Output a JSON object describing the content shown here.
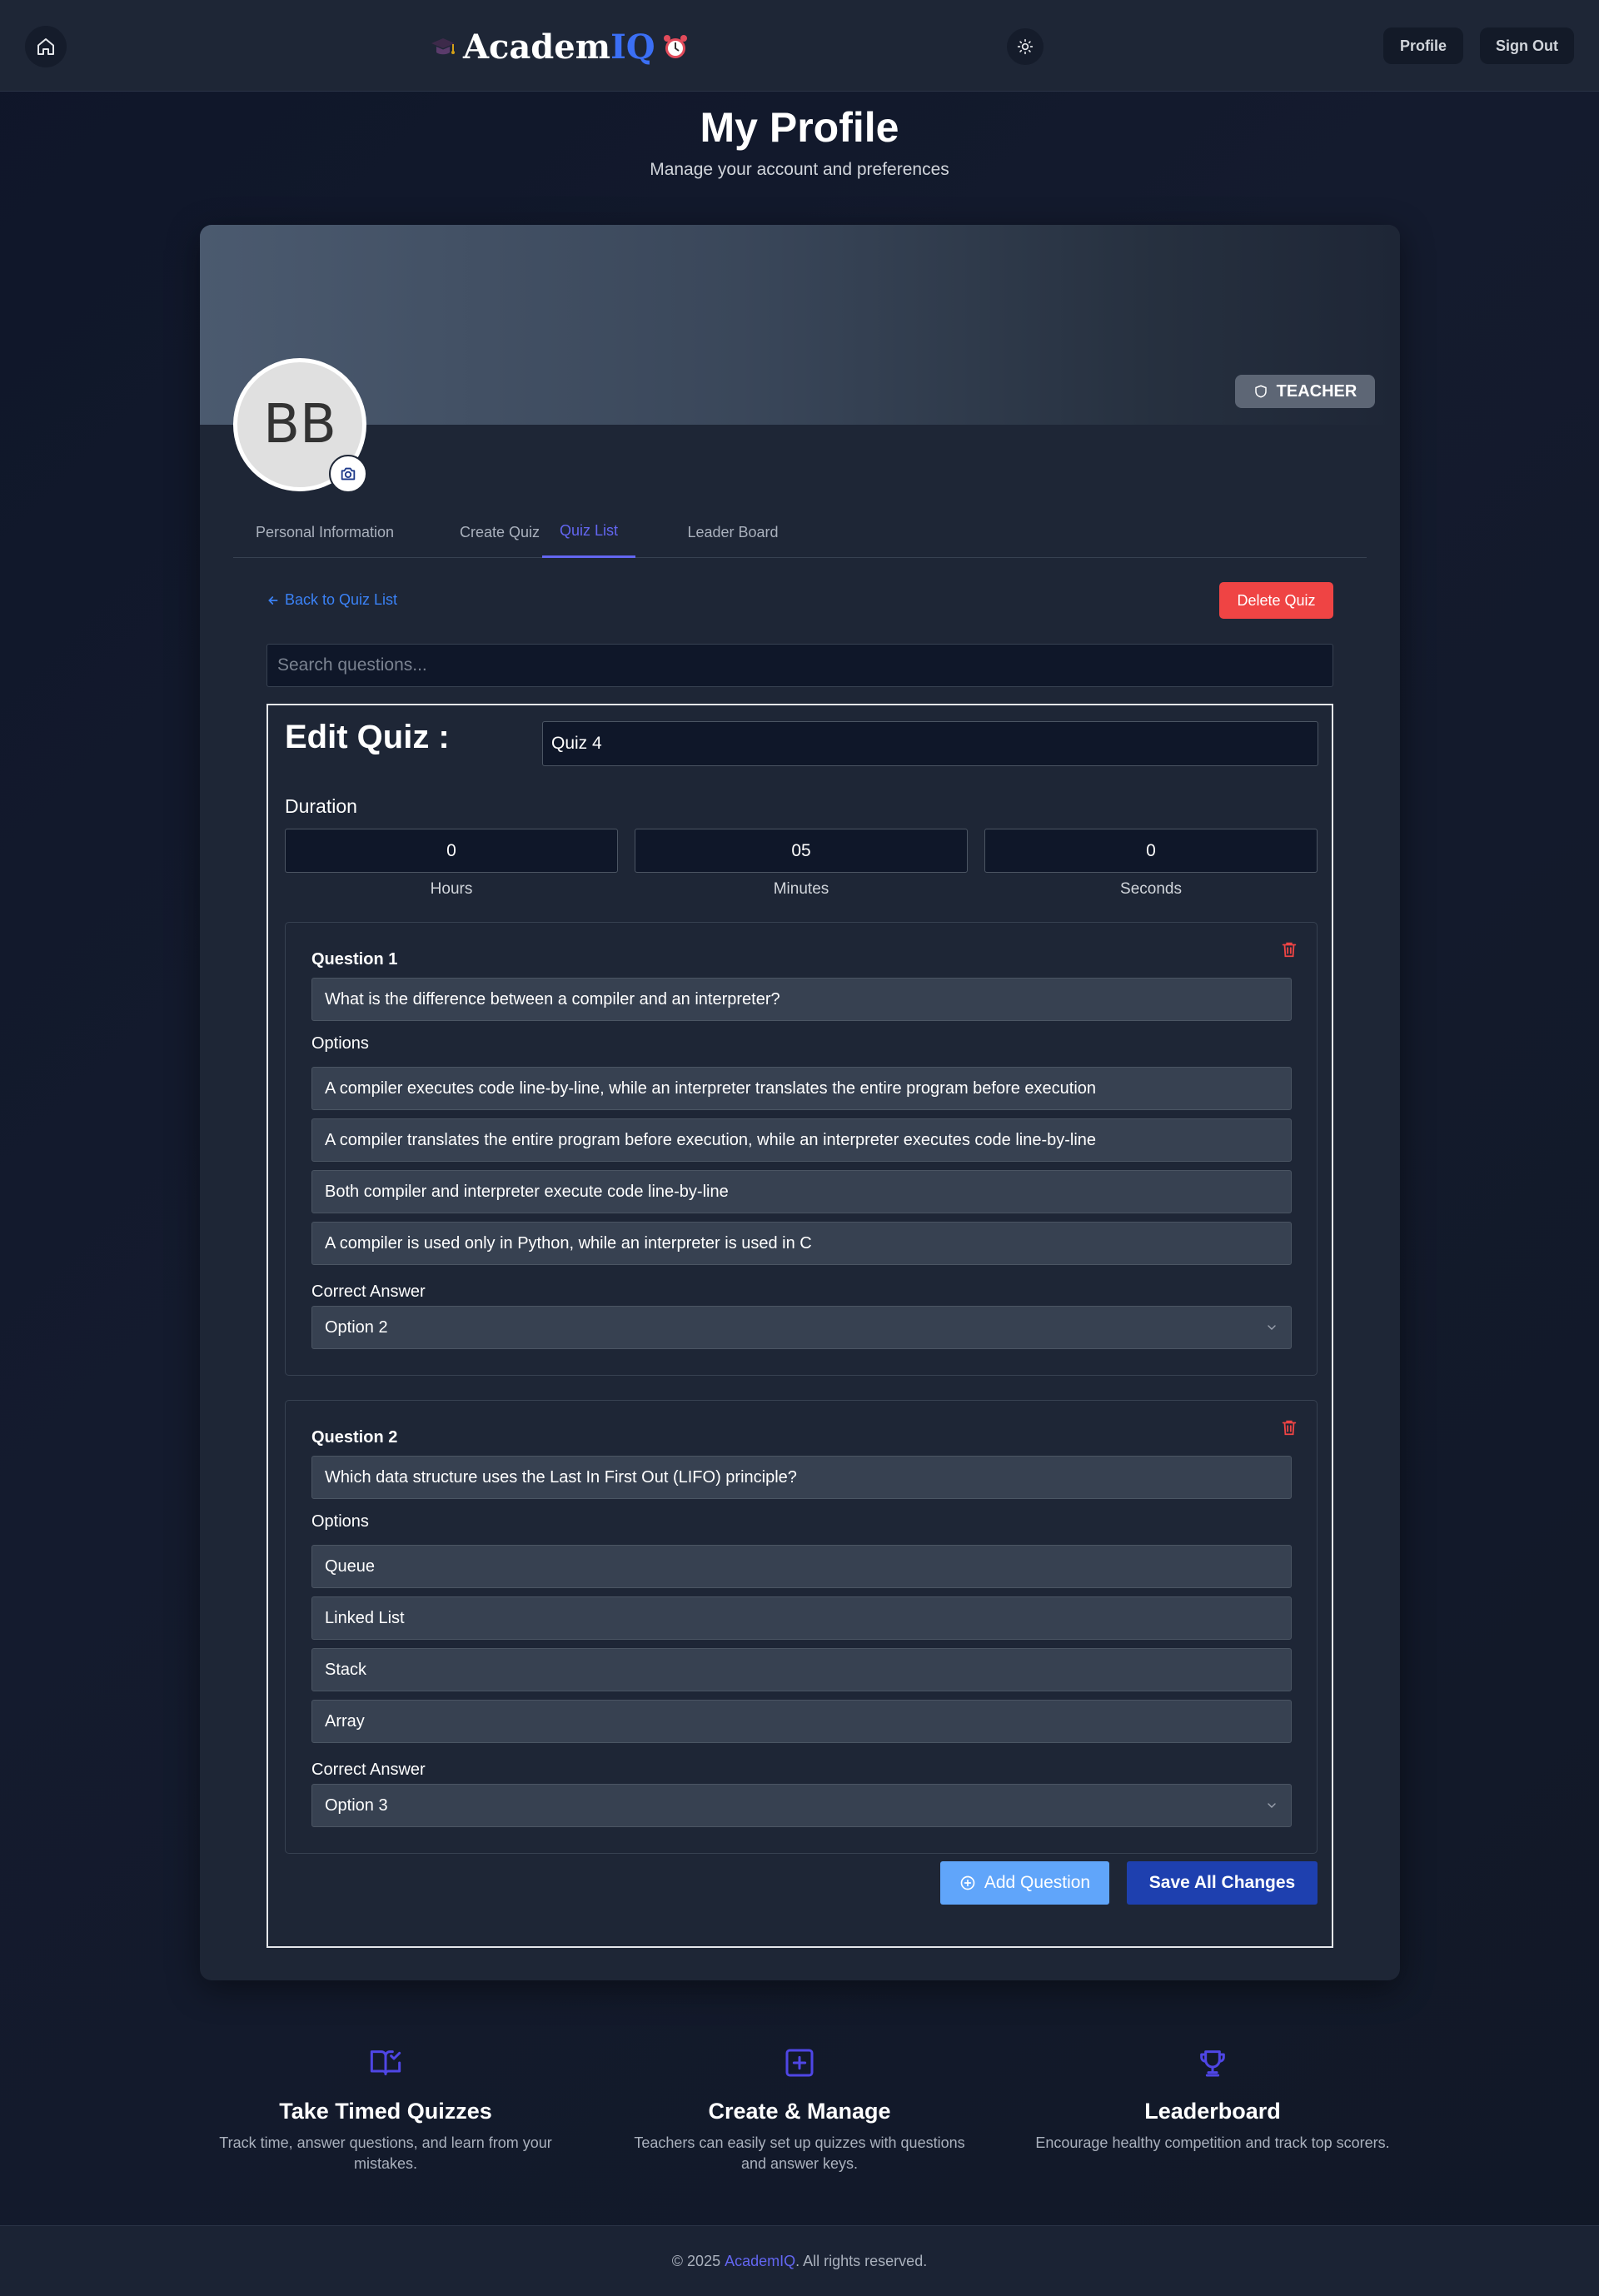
{
  "header": {
    "logo_text_main": "Academ",
    "logo_text_accent": "IQ",
    "logo_icon_left": "graduation-cap-icon",
    "logo_icon_right": "alarm-clock-icon",
    "profile_label": "Profile",
    "signout_label": "Sign Out"
  },
  "page": {
    "title": "My Profile",
    "subtitle": "Manage your account and preferences"
  },
  "profile": {
    "initials": "BB",
    "role_badge": "TEACHER"
  },
  "tabs": [
    {
      "label": "Personal Information",
      "active": false
    },
    {
      "label": "Create Quiz",
      "active": false
    },
    {
      "label": "Quiz List",
      "active": true
    },
    {
      "label": "Leader Board",
      "active": false
    }
  ],
  "quiz_editor": {
    "back_label": "Back to Quiz List",
    "delete_label": "Delete Quiz",
    "search_placeholder": "Search questions...",
    "edit_title": "Edit Quiz :",
    "quiz_name": "Quiz 4",
    "duration_label": "Duration",
    "duration": {
      "hours": "0",
      "hours_label": "Hours",
      "minutes": "05",
      "minutes_label": "Minutes",
      "seconds": "0",
      "seconds_label": "Seconds"
    },
    "options_label": "Options",
    "correct_answer_label": "Correct Answer",
    "questions": [
      {
        "label": "Question 1",
        "text": "What is the difference between a compiler and an interpreter?",
        "options": [
          "A compiler executes code line-by-line, while an interpreter translates the entire program before execution",
          "A compiler translates the entire program before execution, while an interpreter executes code line-by-line",
          "Both compiler and interpreter execute code line-by-line",
          "A compiler is used only in Python, while an interpreter is used in C"
        ],
        "correct_answer": "Option 2"
      },
      {
        "label": "Question 2",
        "text": "Which data structure uses the Last In First Out (LIFO) principle?",
        "options": [
          "Queue",
          "Linked List",
          "Stack",
          "Array"
        ],
        "correct_answer": "Option 3"
      }
    ],
    "add_question_label": "Add Question",
    "save_label": "Save All Changes"
  },
  "features": [
    {
      "icon": "book-check-icon",
      "title": "Take Timed Quizzes",
      "desc": "Track time, answer questions, and learn from your mistakes."
    },
    {
      "icon": "plus-square-icon",
      "title": "Create & Manage",
      "desc": "Teachers can easily set up quizzes with questions and answer keys."
    },
    {
      "icon": "trophy-icon",
      "title": "Leaderboard",
      "desc": "Encourage healthy competition and track top scorers."
    }
  ],
  "footer": {
    "prefix": "© 2025 ",
    "brand": "AcademIQ",
    "suffix": ". All rights reserved."
  },
  "colors": {
    "accent": "#6366f1",
    "link": "#3b82f6",
    "danger": "#ef4444",
    "save": "#1e40af",
    "add": "#60a5fa"
  }
}
